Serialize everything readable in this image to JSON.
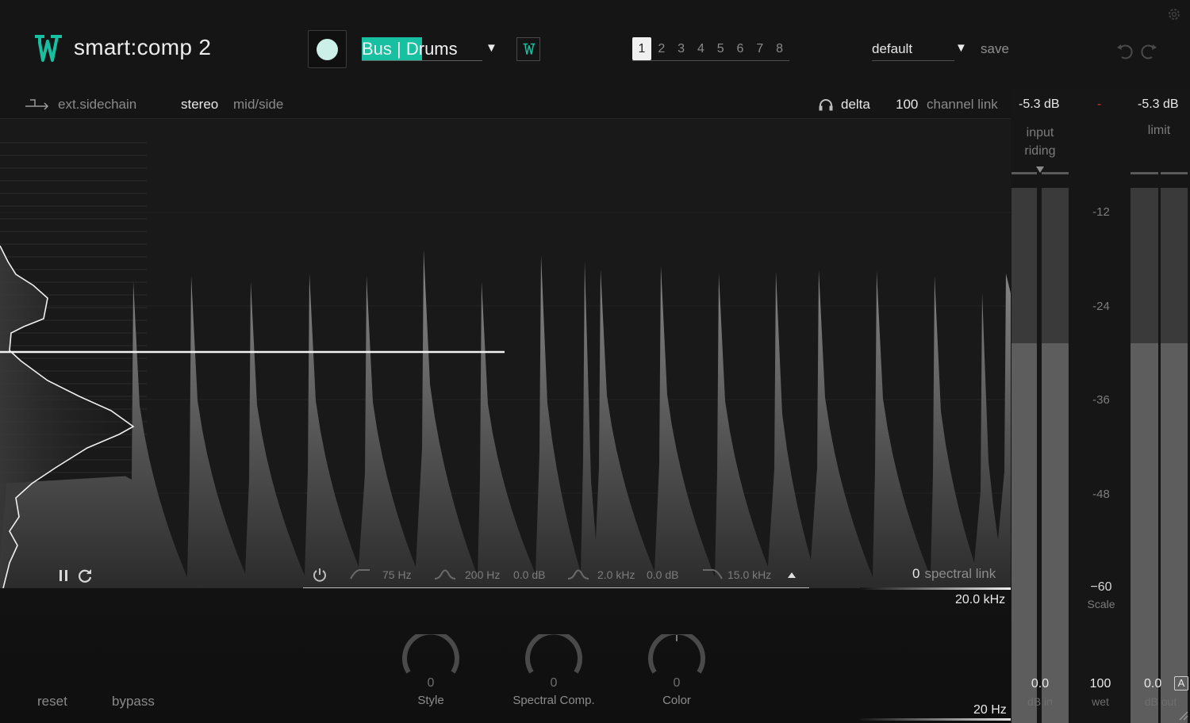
{
  "header": {
    "app_title": "smart:comp 2",
    "profile": "Bus | Drums",
    "preset_slots": [
      "1",
      "2",
      "3",
      "4",
      "5",
      "6",
      "7",
      "8"
    ],
    "active_slot": "1",
    "preset_name": "default",
    "save_label": "save"
  },
  "toolbar": {
    "sidechain_label": "ext.sidechain",
    "mode_stereo": "stereo",
    "mode_midside": "mid/side",
    "delta_label": "delta",
    "channel_link_value": "100",
    "channel_link_label": "channel link"
  },
  "filter_bar": {
    "low_cut": "75 Hz",
    "low_freq": "200 Hz",
    "low_gain": "0.0 dB",
    "mid_freq": "2.0 kHz",
    "mid_gain": "0.0 dB",
    "high_cut": "15.0 kHz",
    "spectral_link_value": "0",
    "spectral_link_label": "spectral link"
  },
  "freq_axis": {
    "high": "20.0 kHz",
    "low": "20 Hz"
  },
  "bottom": {
    "reset_label": "reset",
    "bypass_label": "bypass"
  },
  "knobs": [
    {
      "value": "0",
      "label": "Style"
    },
    {
      "value": "0",
      "label": "Spectral Comp."
    },
    {
      "value": "0",
      "label": "Color"
    }
  ],
  "meters": {
    "input_level": "-5.3 dB",
    "separator": "-",
    "output_level": "-5.3 dB",
    "input_riding_label": "input riding",
    "limit_label": "limit",
    "scale_ticks": [
      "-12",
      "-24",
      "-36",
      "-48",
      "−60"
    ],
    "scale_label": "Scale",
    "db_in_value": "0.0",
    "db_in_label": "dB in",
    "wet_value": "100",
    "wet_label": "wet",
    "db_out_value": "0.0",
    "db_out_label": "dB out",
    "auto_label": "A",
    "level_fraction": 0.71
  },
  "colors": {
    "accent": "#16c0a0",
    "background": "#151515"
  }
}
